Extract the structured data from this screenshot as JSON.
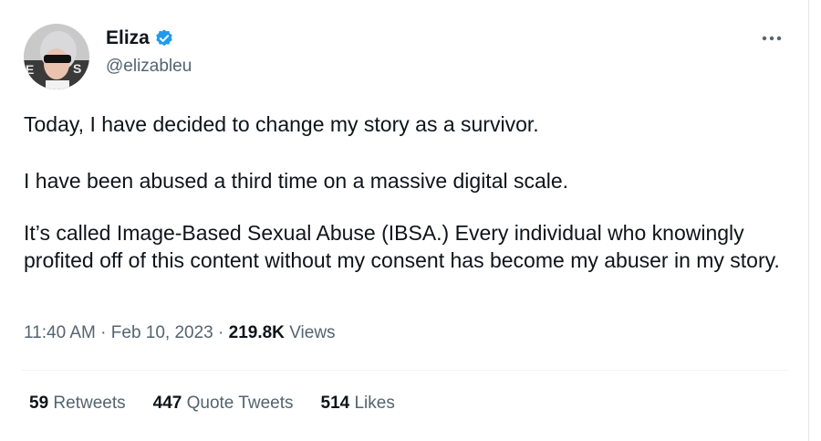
{
  "tweet": {
    "author": {
      "display_name": "Eliza",
      "handle": "@elizableu",
      "verified": true,
      "verified_color": "#1d9bf0"
    },
    "more_icon": "ellipsis-icon",
    "paragraphs": [
      "Today, I have decided to change my story as a survivor.",
      "I have been abused a third time on a massive digital scale.",
      "It’s called Image-Based Sexual Abuse (IBSA.) Every individual who knowingly profited off of this content without my consent has become my abuser in my story."
    ],
    "time": "11:40 AM",
    "separator": "·",
    "date": "Feb 10, 2023",
    "views_count": "219.8K",
    "views_label": "Views",
    "stats": [
      {
        "count": "59",
        "label": "Retweets"
      },
      {
        "count": "447",
        "label": "Quote Tweets"
      },
      {
        "count": "514",
        "label": "Likes"
      }
    ]
  }
}
